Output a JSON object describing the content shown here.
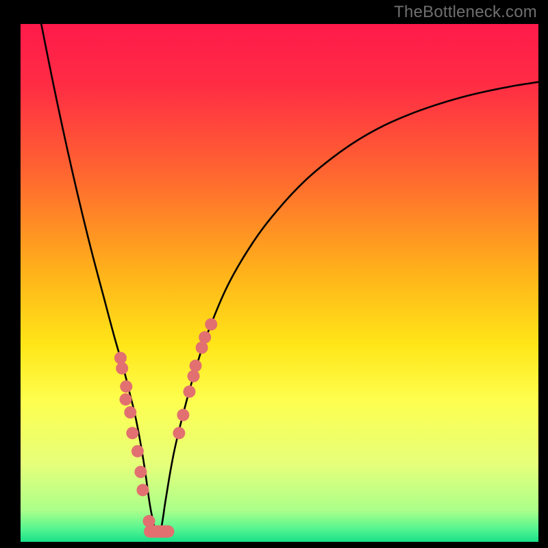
{
  "watermark": {
    "text": "TheBottleneck.com"
  },
  "layout": {
    "frame_left": 30,
    "frame_top": 35,
    "frame_width": 756,
    "frame_height": 756
  },
  "chart_data": {
    "type": "line",
    "title": "",
    "xlabel": "",
    "ylabel": "",
    "x_range": [
      0,
      100
    ],
    "y_range": [
      0,
      100
    ],
    "gradient_stops": [
      {
        "offset": 0.0,
        "color": "#ff1a4a"
      },
      {
        "offset": 0.12,
        "color": "#ff2d44"
      },
      {
        "offset": 0.3,
        "color": "#ff6a2f"
      },
      {
        "offset": 0.48,
        "color": "#ffb21a"
      },
      {
        "offset": 0.62,
        "color": "#ffe618"
      },
      {
        "offset": 0.73,
        "color": "#fdff50"
      },
      {
        "offset": 0.85,
        "color": "#e6ff7a"
      },
      {
        "offset": 0.94,
        "color": "#aaff8a"
      },
      {
        "offset": 0.975,
        "color": "#55f590"
      },
      {
        "offset": 1.0,
        "color": "#18e08a"
      }
    ],
    "curve_min_x": 26,
    "series": [
      {
        "name": "bottleneck-curve",
        "x": [
          4,
          6,
          8,
          10,
          12,
          14,
          16,
          18,
          20,
          21,
          22,
          23,
          24,
          25,
          26,
          27,
          28,
          29,
          30,
          32,
          34,
          36,
          40,
          45,
          50,
          55,
          60,
          65,
          70,
          75,
          80,
          85,
          90,
          95,
          100
        ],
        "y": [
          100,
          90,
          80.5,
          71.5,
          63,
          55,
          47.5,
          40,
          33,
          29,
          25,
          20,
          14,
          7,
          2,
          2,
          8,
          14,
          19,
          27,
          34,
          40,
          49.5,
          58,
          64.5,
          69.8,
          74,
          77.5,
          80.3,
          82.5,
          84.3,
          85.8,
          87,
          88,
          88.8
        ]
      }
    ],
    "flat_bottom": {
      "x1": 25,
      "x2": 28.5,
      "y": 2
    },
    "scatter_left": [
      {
        "x": 19.3,
        "y": 35.5
      },
      {
        "x": 19.6,
        "y": 33.5
      },
      {
        "x": 20.4,
        "y": 30.0
      },
      {
        "x": 20.3,
        "y": 27.5
      },
      {
        "x": 21.2,
        "y": 25.0
      },
      {
        "x": 21.6,
        "y": 21.0
      },
      {
        "x": 22.6,
        "y": 17.5
      },
      {
        "x": 23.2,
        "y": 13.5
      },
      {
        "x": 23.6,
        "y": 10.0
      },
      {
        "x": 24.8,
        "y": 4.0
      },
      {
        "x": 25.8,
        "y": 2.0
      },
      {
        "x": 27.2,
        "y": 2.0
      },
      {
        "x": 28.3,
        "y": 2.0
      }
    ],
    "scatter_right": [
      {
        "x": 30.6,
        "y": 21.0
      },
      {
        "x": 31.4,
        "y": 24.5
      },
      {
        "x": 32.6,
        "y": 29.0
      },
      {
        "x": 33.4,
        "y": 32.0
      },
      {
        "x": 33.8,
        "y": 34.0
      },
      {
        "x": 35.0,
        "y": 37.5
      },
      {
        "x": 35.6,
        "y": 39.5
      },
      {
        "x": 36.8,
        "y": 42.0
      }
    ],
    "dot_color": "#e27070",
    "dot_radius": 9
  }
}
